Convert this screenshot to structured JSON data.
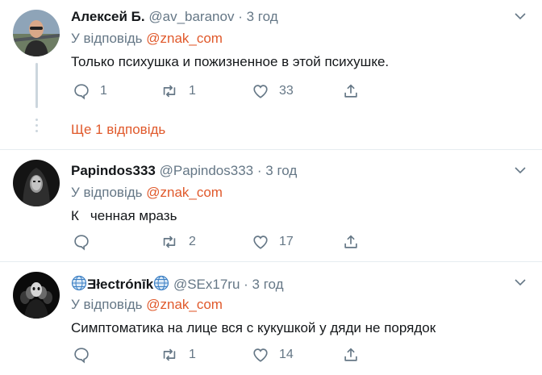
{
  "colors": {
    "accent": "#e0592b",
    "muted": "#657786",
    "border": "#e6ecf0"
  },
  "tweets": [
    {
      "name": "Алексей Б.",
      "handle": "@av_baranov",
      "dot": "·",
      "time": "3 год",
      "reply_prefix": "У відповідь",
      "reply_to": "@znak_com",
      "text": "Только психушка и пожизненное в этой психушке.",
      "reply_count": "1",
      "retweet_count": "1",
      "like_count": "33",
      "more_replies": "Ще 1 відповідь"
    },
    {
      "name": "Papindos333",
      "handle": "@Papindos333",
      "dot": "·",
      "time": "3 год",
      "reply_prefix": "У відповідь",
      "reply_to": "@znak_com",
      "text_start": "К",
      "text_end": "ченная мразь",
      "reply_count": "",
      "retweet_count": "2",
      "like_count": "17"
    },
    {
      "name": "Ǝłectrónīk",
      "handle": "@SEx17ru",
      "dot": "·",
      "time": "3 год",
      "reply_prefix": "У відповідь",
      "reply_to": "@znak_com",
      "text": "Симптоматика на лице вся с кукушкой у дяди не порядок",
      "reply_count": "",
      "retweet_count": "1",
      "like_count": "14"
    }
  ]
}
